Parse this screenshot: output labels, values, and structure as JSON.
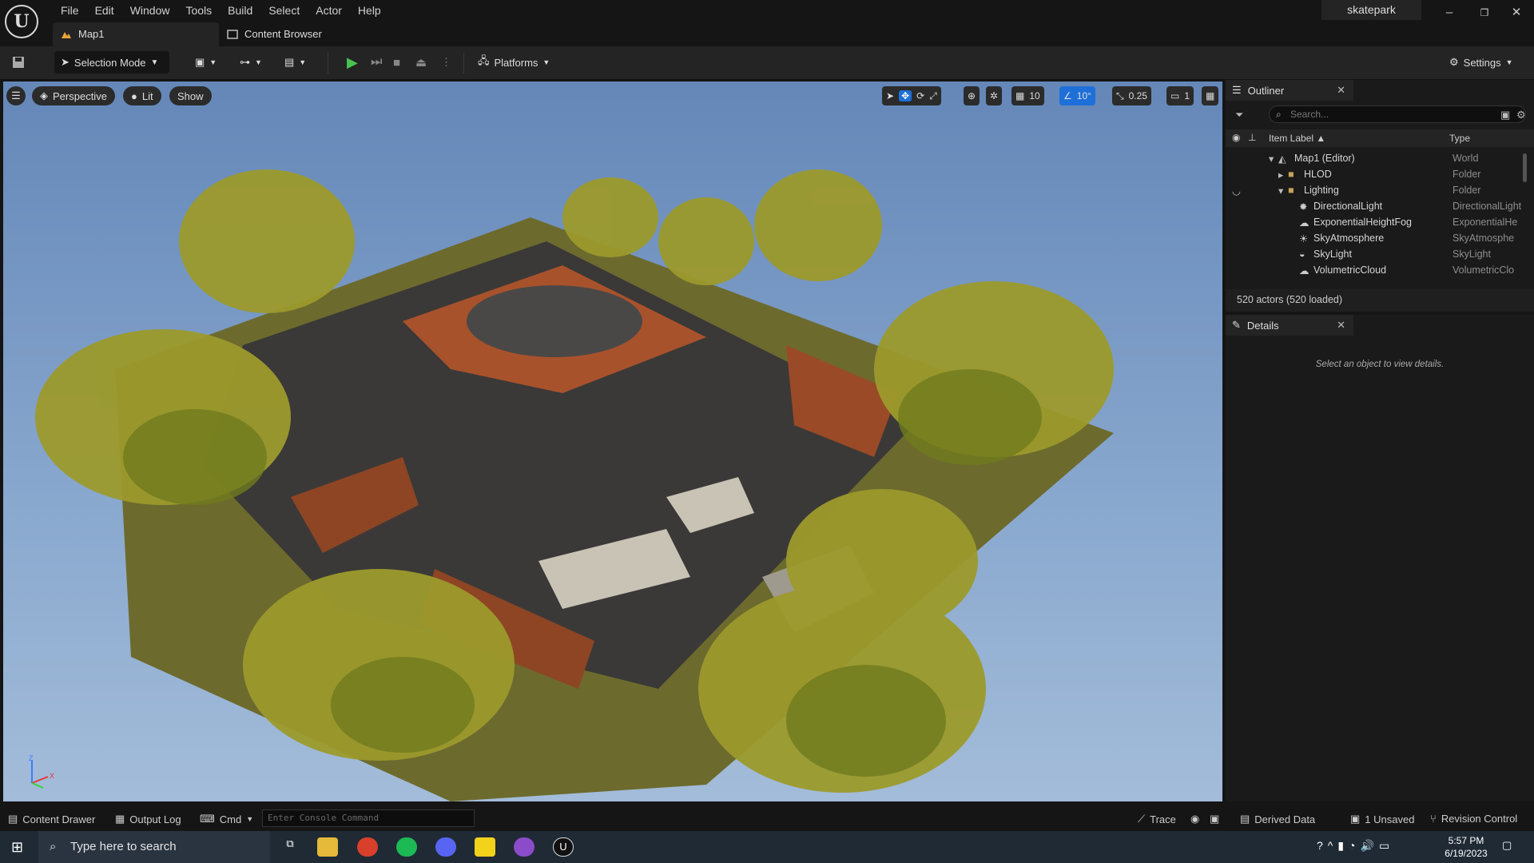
{
  "menu": [
    "File",
    "Edit",
    "Window",
    "Tools",
    "Build",
    "Select",
    "Actor",
    "Help"
  ],
  "tabs": {
    "level": "Map1",
    "content_browser": "Content Browser"
  },
  "project_name": "skatepark",
  "toolbar": {
    "selection_mode": "Selection Mode",
    "platforms": "Platforms",
    "settings": "Settings"
  },
  "viewport": {
    "perspective": "Perspective",
    "lit": "Lit",
    "show": "Show",
    "grid_snap": "10",
    "rotation_snap": "10°",
    "scale_snap": "0.25",
    "camera_speed": "1"
  },
  "outliner": {
    "tab": "Outliner",
    "search_placeholder": "Search...",
    "col_label": "Item Label ▲",
    "col_type": "Type",
    "rows": [
      {
        "label": "Map1 (Editor)",
        "type": "World"
      },
      {
        "label": "HLOD",
        "type": "Folder"
      },
      {
        "label": "Lighting",
        "type": "Folder"
      },
      {
        "label": "DirectionalLight",
        "type": "DirectionalLight"
      },
      {
        "label": "ExponentialHeightFog",
        "type": "ExponentialHe"
      },
      {
        "label": "SkyAtmosphere",
        "type": "SkyAtmosphe"
      },
      {
        "label": "SkyLight",
        "type": "SkyLight"
      },
      {
        "label": "VolumetricCloud",
        "type": "VolumetricClo"
      }
    ],
    "actor_count": "520 actors (520 loaded)"
  },
  "details": {
    "tab": "Details",
    "hint": "Select an object to view details."
  },
  "statusbar": {
    "content_drawer": "Content Drawer",
    "output_log": "Output Log",
    "cmd": "Cmd",
    "console_placeholder": "Enter Console Command",
    "trace": "Trace",
    "derived_data": "Derived Data",
    "unsaved": "1 Unsaved",
    "revision_control": "Revision Control"
  },
  "taskbar": {
    "search": "Type here to search",
    "time": "5:57 PM",
    "date": "6/19/2023"
  },
  "colors": {
    "accent": "#1f6fd8",
    "play": "#49c24f",
    "folder": "#c8a35a"
  }
}
